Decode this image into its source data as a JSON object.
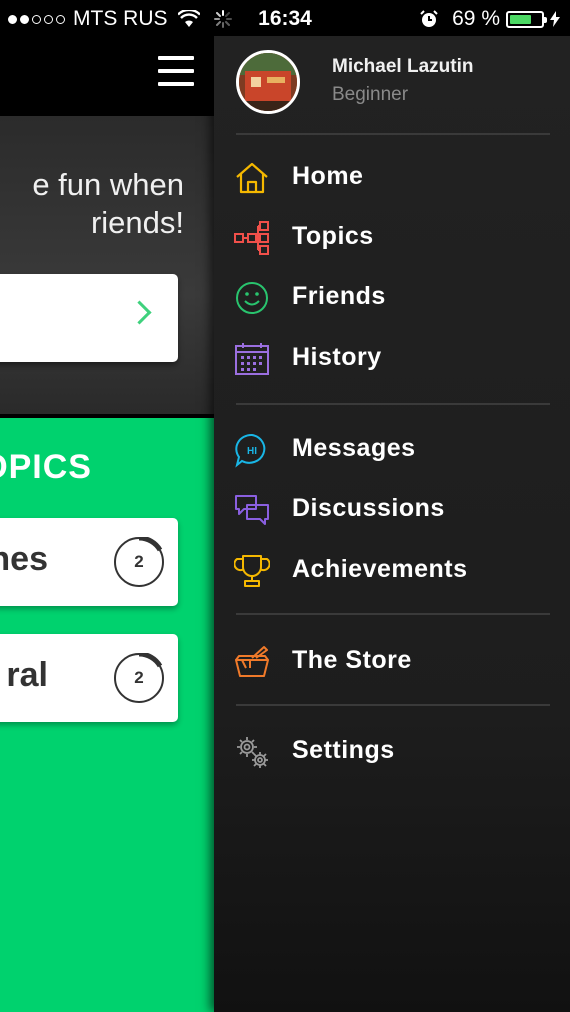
{
  "status_bar": {
    "carrier": "MTS RUS",
    "time": "16:34",
    "battery_percent": "69 %",
    "battery_level": 0.69
  },
  "main": {
    "promo_text_line1": "e fun when",
    "promo_text_line2": "riends!",
    "topics_heading": "OPICS",
    "topic_cards": [
      {
        "name": "nes",
        "count": "2"
      },
      {
        "name": "ral",
        "count": "2"
      }
    ]
  },
  "drawer": {
    "user": {
      "name": "Michael Lazutin",
      "level": "Beginner"
    },
    "items": [
      {
        "label": "Home",
        "icon": "home-icon",
        "color": "#f5b800"
      },
      {
        "label": "Topics",
        "icon": "topics-tree-icon",
        "color": "#f0504a"
      },
      {
        "label": "Friends",
        "icon": "smiley-icon",
        "color": "#29c46e"
      },
      {
        "label": "History",
        "icon": "calendar-icon",
        "color": "#9b6fe0"
      },
      {
        "label": "Messages",
        "icon": "chat-hi-icon",
        "color": "#19b6e6"
      },
      {
        "label": "Discussions",
        "icon": "discussion-bubbles-icon",
        "color": "#8a5fe0"
      },
      {
        "label": "Achievements",
        "icon": "trophy-icon",
        "color": "#f5b800"
      },
      {
        "label": "The Store",
        "icon": "store-mortar-icon",
        "color": "#f07a2a"
      },
      {
        "label": "Settings",
        "icon": "gears-icon",
        "color": "#9a9a9a"
      }
    ]
  },
  "colors": {
    "accent_green": "#00d26e",
    "drawer_bg": "#1f1f1f"
  }
}
